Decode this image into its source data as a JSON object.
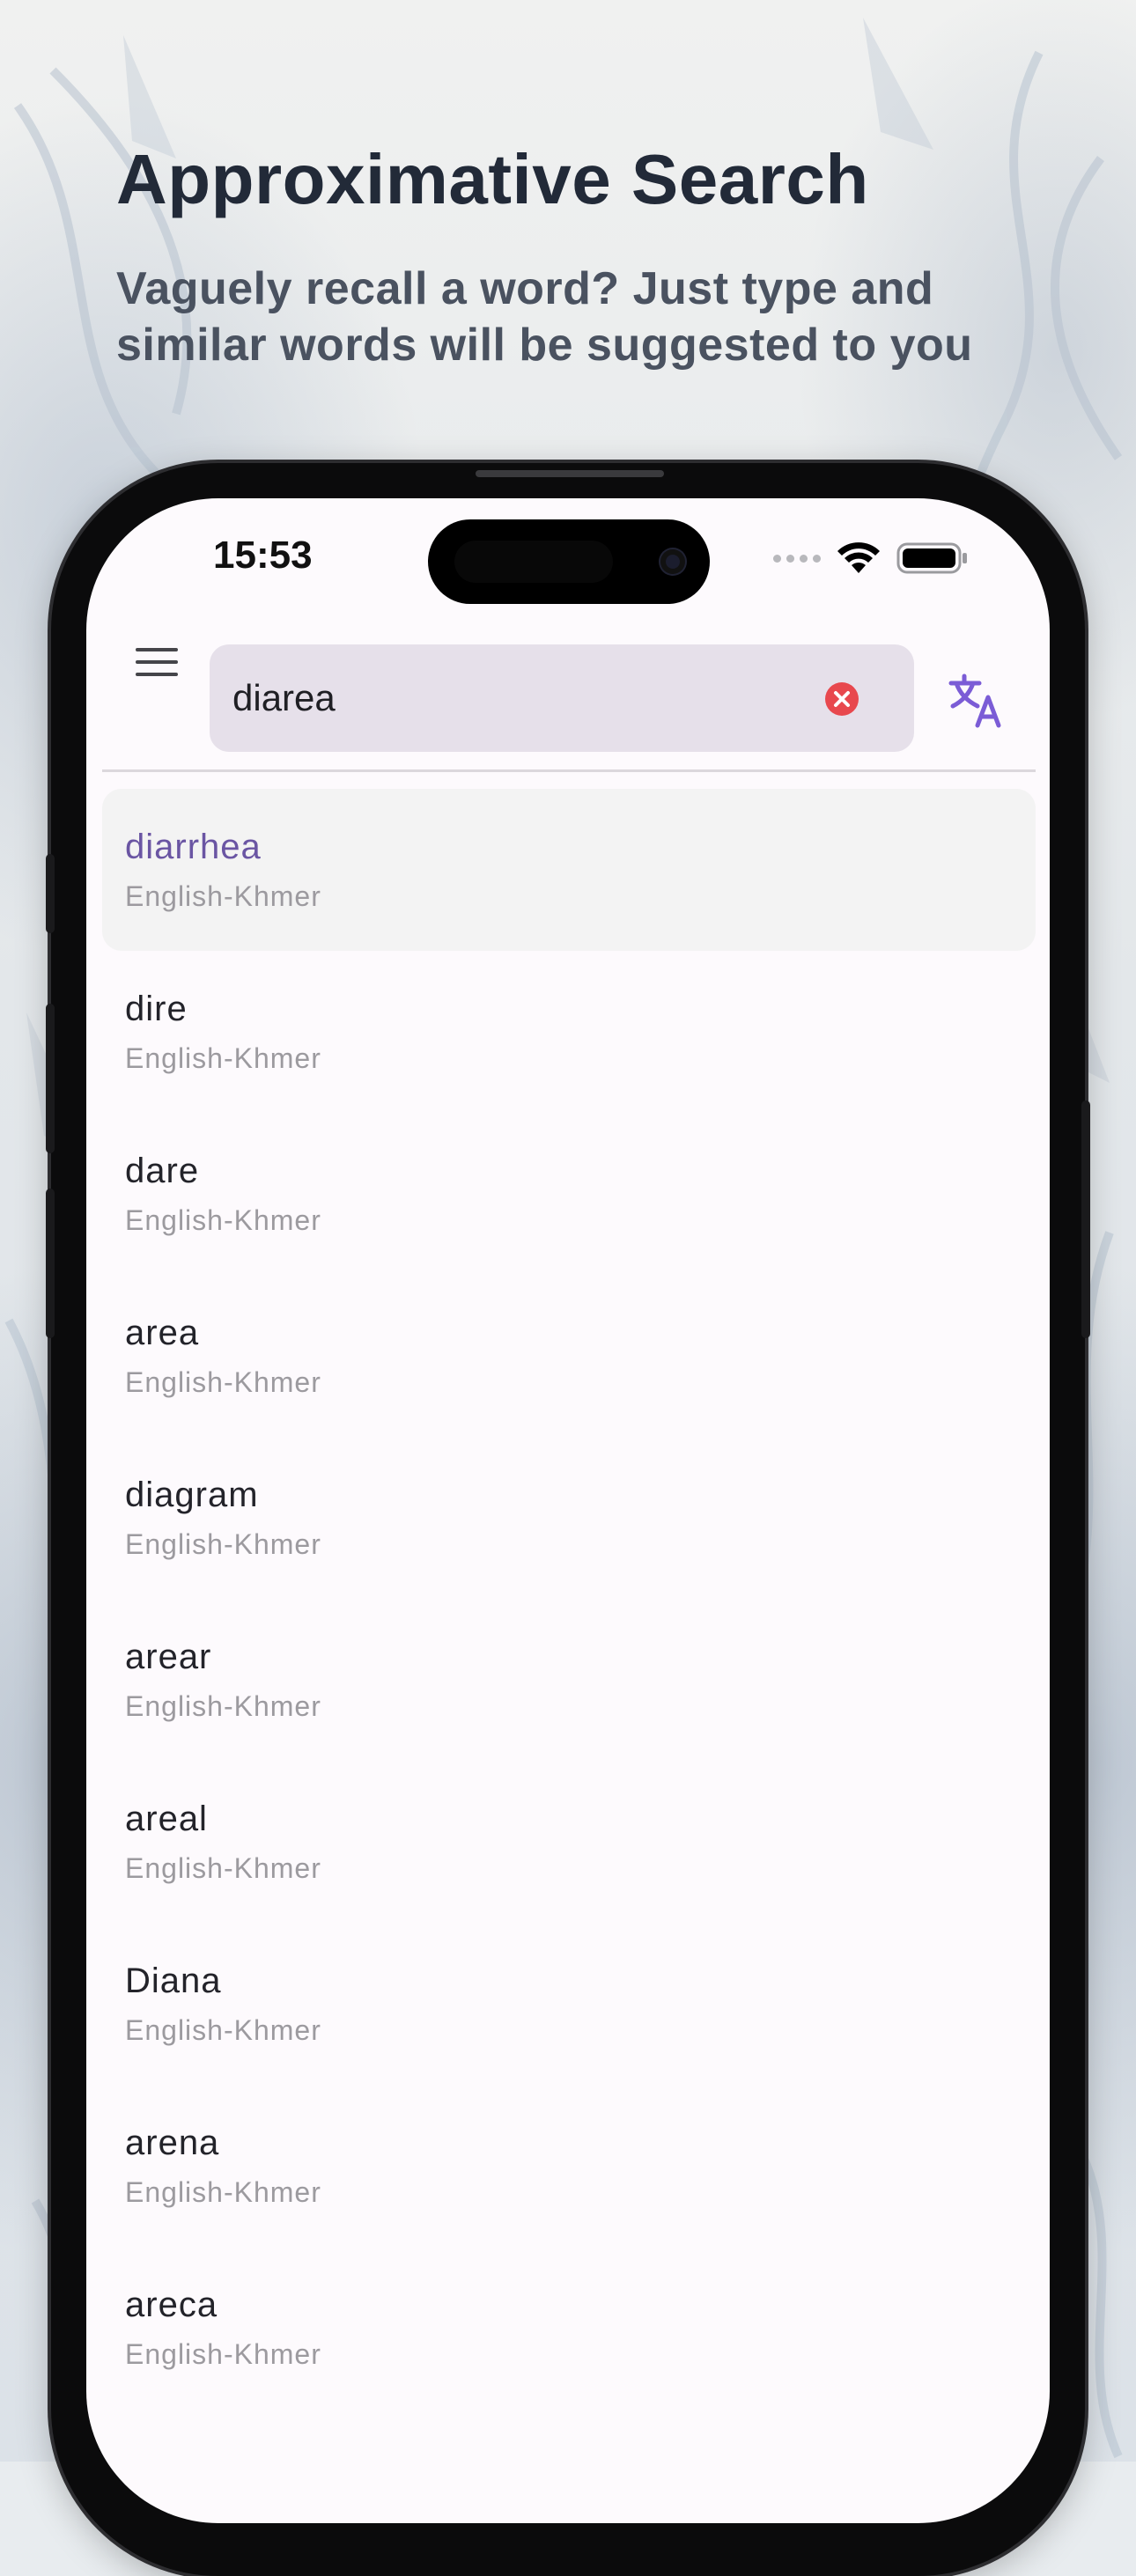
{
  "hero": {
    "title": "Approximative Search",
    "subtitle": "Vaguely recall a word? Just type and similar words will be suggested to you"
  },
  "status_bar": {
    "time": "15:53",
    "icons": [
      "signal-dots-icon",
      "wifi-icon",
      "battery-icon"
    ]
  },
  "app_bar": {
    "menu_icon": "hamburger-menu-icon",
    "search_value": "diarea",
    "clear_icon": "clear-circle-icon",
    "translate_icon": "translate-icon"
  },
  "colors": {
    "accent": "#6a55a3",
    "translate_icon": "#7b5cd6",
    "clear_icon": "#e8484e",
    "search_bg": "#e6e0ea",
    "selected_row_bg": "#f3f3f3",
    "title": "#222a38",
    "subtitle": "#4a5260"
  },
  "results": [
    {
      "word": "diarrhea",
      "dict": "English-Khmer",
      "selected": true
    },
    {
      "word": "dire",
      "dict": "English-Khmer"
    },
    {
      "word": "dare",
      "dict": "English-Khmer"
    },
    {
      "word": "area",
      "dict": "English-Khmer"
    },
    {
      "word": "diagram",
      "dict": "English-Khmer"
    },
    {
      "word": "arear",
      "dict": "English-Khmer"
    },
    {
      "word": "areal",
      "dict": "English-Khmer"
    },
    {
      "word": "Diana",
      "dict": "English-Khmer"
    },
    {
      "word": "arena",
      "dict": "English-Khmer"
    },
    {
      "word": "areca",
      "dict": "English-Khmer"
    }
  ]
}
